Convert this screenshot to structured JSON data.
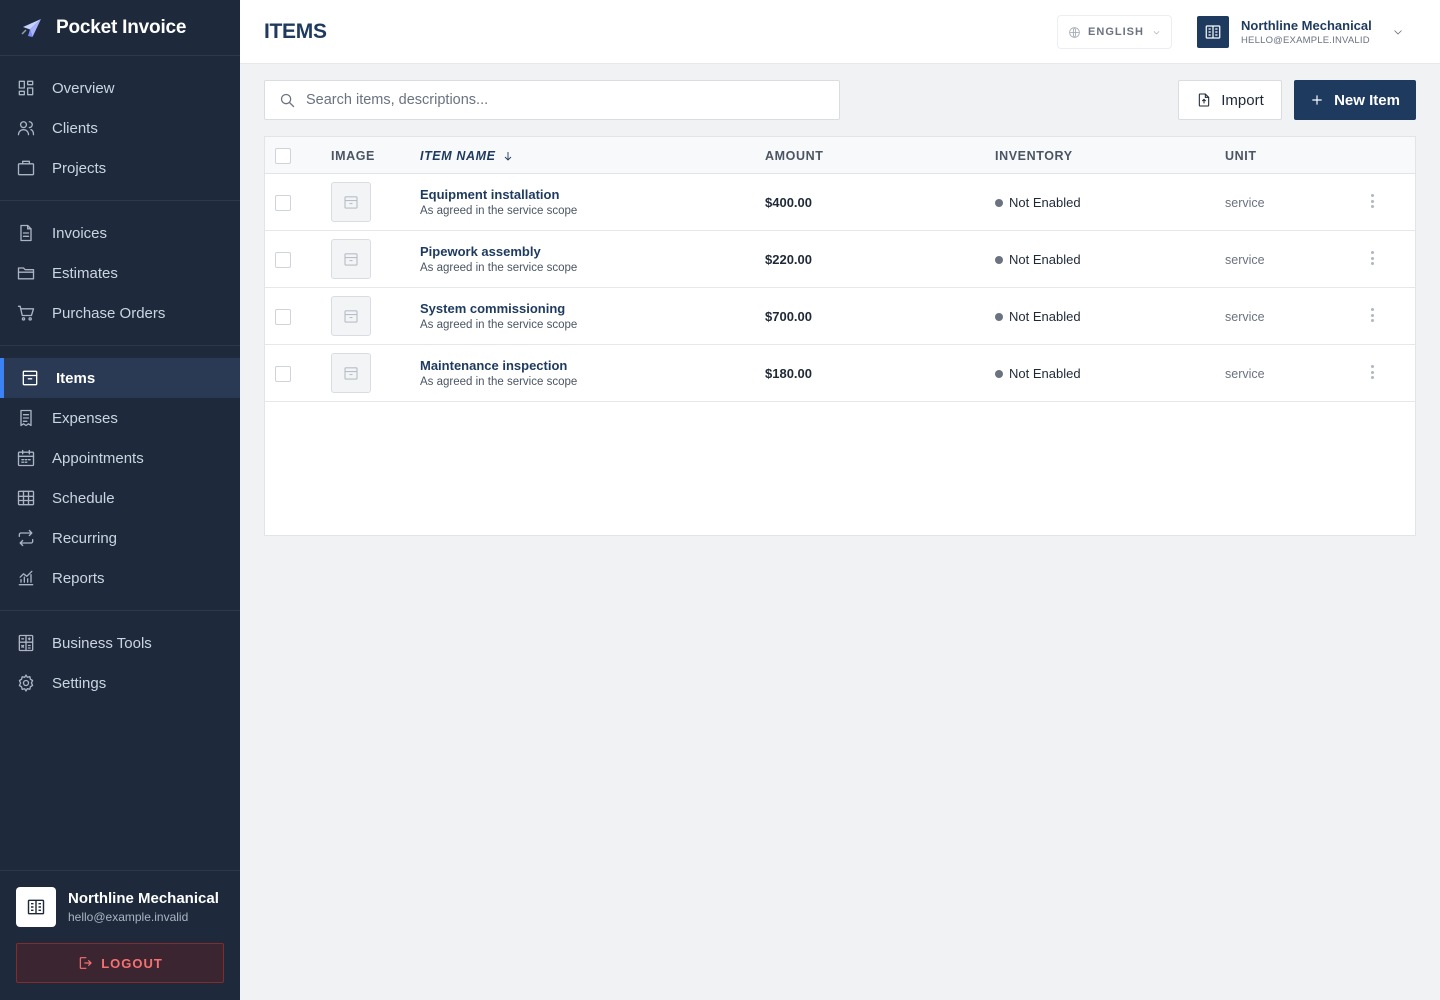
{
  "app": {
    "name": "Pocket Invoice"
  },
  "page": {
    "title": "ITEMS"
  },
  "sidebar": {
    "groups": [
      [
        {
          "label": "Overview",
          "icon": "grid-icon"
        },
        {
          "label": "Clients",
          "icon": "users-icon"
        },
        {
          "label": "Projects",
          "icon": "briefcase-icon"
        }
      ],
      [
        {
          "label": "Invoices",
          "icon": "document-icon"
        },
        {
          "label": "Estimates",
          "icon": "folder-icon"
        },
        {
          "label": "Purchase Orders",
          "icon": "cart-icon"
        }
      ],
      [
        {
          "label": "Items",
          "icon": "archive-icon",
          "active": true
        },
        {
          "label": "Expenses",
          "icon": "receipt-icon"
        },
        {
          "label": "Appointments",
          "icon": "calendar-icon"
        },
        {
          "label": "Schedule",
          "icon": "table-icon"
        },
        {
          "label": "Recurring",
          "icon": "repeat-icon"
        },
        {
          "label": "Reports",
          "icon": "chart-icon"
        }
      ],
      [
        {
          "label": "Business Tools",
          "icon": "calculator-icon"
        },
        {
          "label": "Settings",
          "icon": "gear-icon"
        }
      ]
    ],
    "footer": {
      "business_name": "Northline Mechanical",
      "email": "hello@example.invalid",
      "logout_label": "LOGOUT"
    }
  },
  "header": {
    "language": "ENGLISH",
    "user_name": "Northline Mechanical",
    "user_email": "HELLO@EXAMPLE.INVALID"
  },
  "toolbar": {
    "search_placeholder": "Search items, descriptions...",
    "import_label": "Import",
    "new_item_label": "New Item"
  },
  "table": {
    "columns": {
      "image": "IMAGE",
      "item_name": "ITEM NAME",
      "amount": "AMOUNT",
      "inventory": "INVENTORY",
      "unit": "UNIT"
    },
    "sort": {
      "column": "item_name",
      "direction": "descending"
    },
    "rows": [
      {
        "name": "Equipment installation",
        "description": "As agreed in the service scope",
        "amount": "$400.00",
        "inventory": "Not Enabled",
        "unit": "service"
      },
      {
        "name": "Pipework assembly",
        "description": "As agreed in the service scope",
        "amount": "$220.00",
        "inventory": "Not Enabled",
        "unit": "service"
      },
      {
        "name": "System commissioning",
        "description": "As agreed in the service scope",
        "amount": "$700.00",
        "inventory": "Not Enabled",
        "unit": "service"
      },
      {
        "name": "Maintenance inspection",
        "description": "As agreed in the service scope",
        "amount": "$180.00",
        "inventory": "Not Enabled",
        "unit": "service"
      }
    ]
  },
  "colors": {
    "sidebar_bg": "#1e293b",
    "accent": "#1e3a5f",
    "active_indicator": "#3b82f6",
    "logout": "#f87171",
    "status_dot": "#6b7280"
  }
}
